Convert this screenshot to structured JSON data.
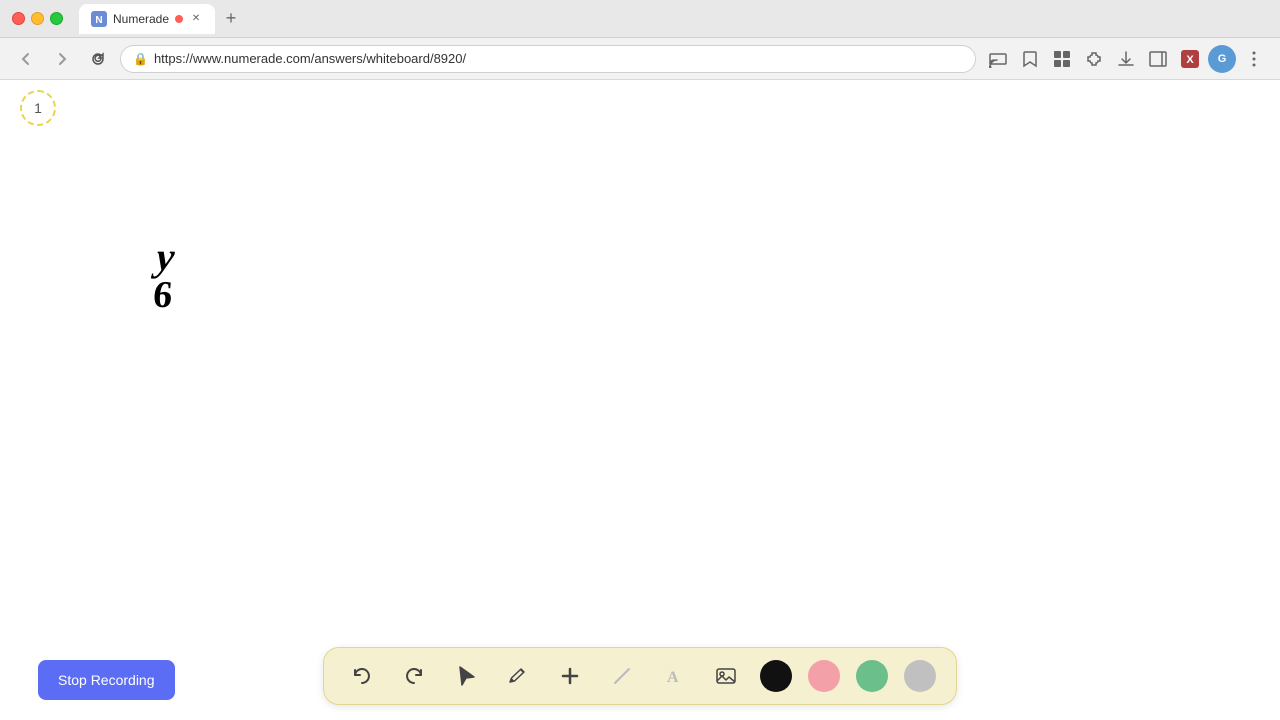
{
  "browser": {
    "tab_title": "Numerade",
    "tab_url": "https://www.numerade.com/answers/whiteboard/8920/",
    "favicon": "N",
    "new_tab_label": "+",
    "recording_dot_color": "#ff5f57"
  },
  "nav": {
    "back_label": "←",
    "forward_label": "→",
    "refresh_label": "↻",
    "url": "https://www.numerade.com/answers/whiteboard/8920/",
    "lock_icon": "🔒"
  },
  "whiteboard": {
    "page_number": "1",
    "drawn_text_line1": "y",
    "drawn_text_line2": "6"
  },
  "toolbar": {
    "undo_label": "↺",
    "redo_label": "↻",
    "select_label": "▲",
    "pen_label": "✏",
    "add_label": "+",
    "eraser_label": "/",
    "text_label": "A",
    "image_label": "🖼",
    "colors": [
      {
        "name": "black",
        "hex": "#111111"
      },
      {
        "name": "pink",
        "hex": "#f4a0a8"
      },
      {
        "name": "green",
        "hex": "#6abf8a"
      },
      {
        "name": "gray",
        "hex": "#c0c0c0"
      }
    ]
  },
  "stop_recording": {
    "label": "Stop Recording"
  }
}
